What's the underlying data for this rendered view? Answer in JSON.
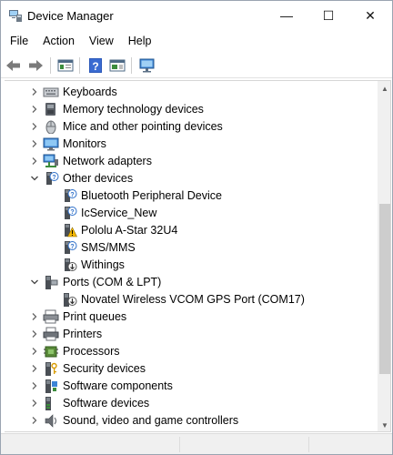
{
  "window": {
    "title": "Device Manager"
  },
  "titlebar": {
    "minimize_glyph": "—",
    "maximize_glyph": "☐",
    "close_glyph": "✕"
  },
  "menu": [
    {
      "label": "File"
    },
    {
      "label": "Action"
    },
    {
      "label": "View"
    },
    {
      "label": "Help"
    }
  ],
  "toolbar": [
    {
      "icon": "back-arrow-icon"
    },
    {
      "icon": "forward-arrow-icon"
    },
    {
      "icon": "properties-pane-icon"
    },
    {
      "icon": "help-icon"
    },
    {
      "icon": "show-hide-pane-icon"
    },
    {
      "icon": "scan-hardware-icon"
    }
  ],
  "tree": [
    {
      "label": "Keyboards",
      "icon": "keyboard-icon",
      "level": 0,
      "expander": "collapsed"
    },
    {
      "label": "Memory technology devices",
      "icon": "memory-device-icon",
      "level": 0,
      "expander": "collapsed"
    },
    {
      "label": "Mice and other pointing devices",
      "icon": "mouse-icon",
      "level": 0,
      "expander": "collapsed"
    },
    {
      "label": "Monitors",
      "icon": "monitor-icon",
      "level": 0,
      "expander": "collapsed"
    },
    {
      "label": "Network adapters",
      "icon": "network-adapter-icon",
      "level": 0,
      "expander": "collapsed"
    },
    {
      "label": "Other devices",
      "icon": "unknown-device-icon",
      "level": 0,
      "expander": "expanded"
    },
    {
      "label": "Bluetooth Peripheral Device",
      "icon": "unknown-device-icon",
      "level": 1,
      "expander": "none"
    },
    {
      "label": "IcService_New",
      "icon": "unknown-device-icon",
      "level": 1,
      "expander": "none"
    },
    {
      "label": "Pololu A-Star 32U4",
      "icon": "warning-device-icon",
      "level": 1,
      "expander": "none"
    },
    {
      "label": "SMS/MMS",
      "icon": "unknown-device-icon",
      "level": 1,
      "expander": "none"
    },
    {
      "label": "Withings",
      "icon": "download-device-icon",
      "level": 1,
      "expander": "none"
    },
    {
      "label": "Ports (COM & LPT)",
      "icon": "port-icon",
      "level": 0,
      "expander": "expanded"
    },
    {
      "label": "Novatel Wireless VCOM GPS Port (COM17)",
      "icon": "port-download-icon",
      "level": 1,
      "expander": "none"
    },
    {
      "label": "Print queues",
      "icon": "print-queue-icon",
      "level": 0,
      "expander": "collapsed"
    },
    {
      "label": "Printers",
      "icon": "printer-icon",
      "level": 0,
      "expander": "collapsed"
    },
    {
      "label": "Processors",
      "icon": "processor-icon",
      "level": 0,
      "expander": "collapsed"
    },
    {
      "label": "Security devices",
      "icon": "security-device-icon",
      "level": 0,
      "expander": "collapsed"
    },
    {
      "label": "Software components",
      "icon": "software-component-icon",
      "level": 0,
      "expander": "collapsed"
    },
    {
      "label": "Software devices",
      "icon": "software-device-icon",
      "level": 0,
      "expander": "collapsed"
    },
    {
      "label": "Sound, video and game controllers",
      "icon": "sound-icon",
      "level": 0,
      "expander": "collapsed"
    }
  ],
  "scrollbar": {
    "up_glyph": "▲",
    "down_glyph": "▼"
  },
  "colors": {
    "accent": "#1e6fc1",
    "warning": "#f5b800",
    "window_border": "#9aa4b1"
  }
}
